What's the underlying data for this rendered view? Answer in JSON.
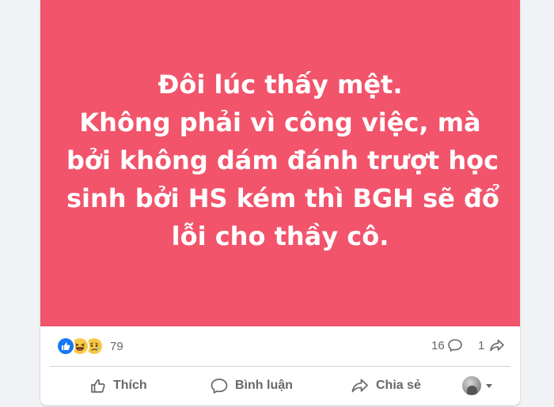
{
  "post": {
    "background_color": "#f2546b",
    "text_lines": [
      "Đôi lúc thấy mệt.",
      "Không phải vì công việc, mà",
      "bởi không dám đánh trượt học",
      "sinh bởi HS kém thì BGH sẽ đổ",
      "lỗi cho thầy cô."
    ]
  },
  "stats": {
    "reactions": [
      "like-icon",
      "haha-icon",
      "sad-icon"
    ],
    "reaction_count": "79",
    "comment_count": "16",
    "share_count": "1"
  },
  "actions": {
    "like_label": "Thích",
    "comment_label": "Bình luận",
    "share_label": "Chia sẻ"
  }
}
